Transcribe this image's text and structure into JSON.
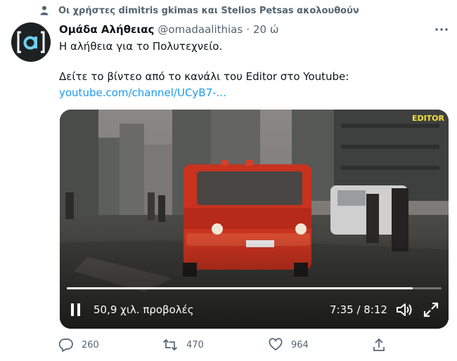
{
  "social_context": "Οι χρήστες dimitris gkimas και Stelios Petsas ακολουθούν",
  "author": {
    "name": "Ομάδα Αλήθειας",
    "handle": "@omadaalithias",
    "separator": "·",
    "time": "20 ώ"
  },
  "tweet": {
    "line1": "Η αλήθεια για το Πολυτεχνείο.",
    "line2": "Δείτε το βίντεο από το κανάλι του Editor στο Youtube:",
    "link": "youtube.com/channel/UCyB7-..."
  },
  "video": {
    "views": "50,9 χιλ. προβολές",
    "timecode": "7:35 / 8:12",
    "progress": 0.924,
    "watermark": "EDITOR"
  },
  "actions": {
    "replies": "260",
    "retweets": "470",
    "likes": "964"
  },
  "colors": {
    "accent": "#1d9bf0",
    "secondary_text": "#536471",
    "avatar_bg": "#1e2124",
    "avatar_accent": "#6fd0f2"
  }
}
